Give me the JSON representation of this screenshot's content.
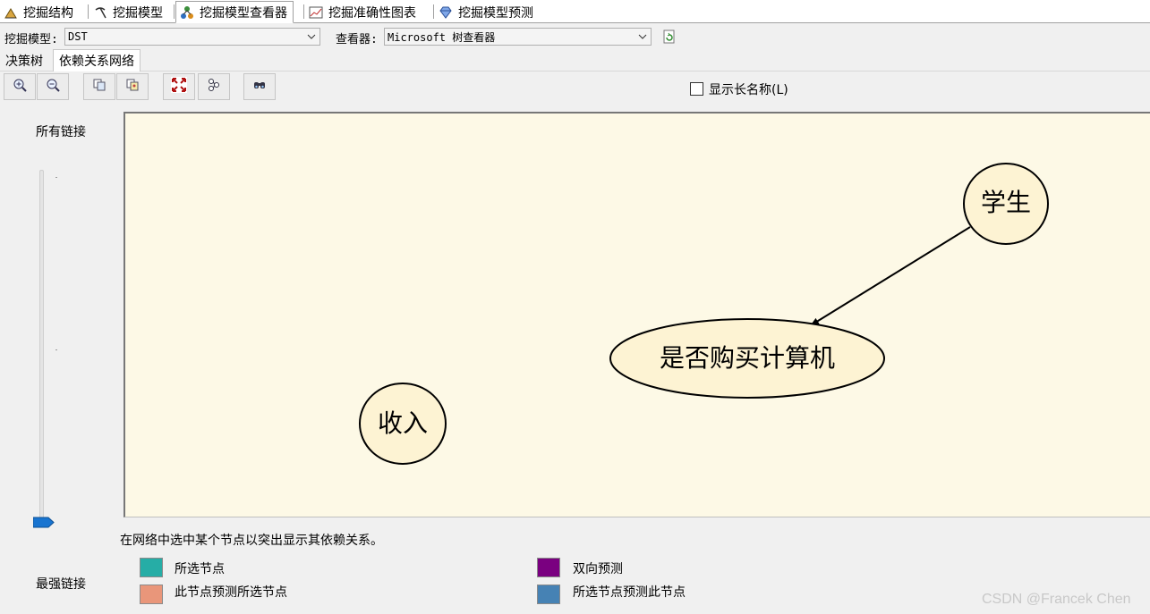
{
  "tabs": [
    {
      "label": "挖掘结构",
      "icon": "mining-structure-icon"
    },
    {
      "label": "挖掘模型",
      "icon": "pickaxe-icon"
    },
    {
      "label": "挖掘模型查看器",
      "icon": "model-viewer-icon",
      "active": true
    },
    {
      "label": "挖掘准确性图表",
      "icon": "accuracy-chart-icon"
    },
    {
      "label": "挖掘模型预测",
      "icon": "diamond-icon"
    }
  ],
  "model_row": {
    "model_label": "挖掘模型:",
    "model_value": "DST",
    "viewer_label": "查看器:",
    "viewer_value": "Microsoft 树查看器",
    "refresh_icon": "refresh-icon"
  },
  "sub_tabs": [
    {
      "label": "决策树"
    },
    {
      "label": "依赖关系网络",
      "active": true
    }
  ],
  "toolbar": {
    "buttons": [
      "zoom-in-icon",
      "zoom-out-icon",
      "copy-icon",
      "copy-image-icon",
      "fit-to-window-icon",
      "layout-icon",
      "find-node-icon"
    ],
    "show_long_names": "显示长名称(L)"
  },
  "slider": {
    "top_label": "所有链接",
    "bottom_label": "最强链接",
    "value": 0
  },
  "network": {
    "nodes": [
      {
        "id": "student",
        "label": "学生"
      },
      {
        "id": "buy",
        "label": "是否购买计算机"
      },
      {
        "id": "income",
        "label": "收入"
      }
    ],
    "edges": [
      {
        "from": "学生",
        "to": "是否购买计算机"
      }
    ]
  },
  "hint": "在网络中选中某个节点以突出显示其依赖关系。",
  "legend": [
    {
      "label": "所选节点",
      "color": "#26ada6"
    },
    {
      "label": "此节点预测所选节点",
      "color": "#e9967a"
    },
    {
      "label": "双向预测",
      "color": "#7a0080"
    },
    {
      "label": "所选节点预测此节点",
      "color": "#4682b4"
    }
  ],
  "watermark": "CSDN @Francek Chen"
}
